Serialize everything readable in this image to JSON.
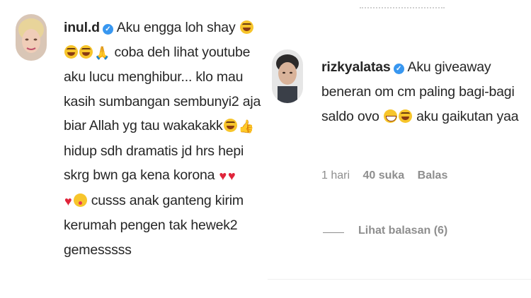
{
  "left_comment": {
    "username": "inul.d",
    "lines": [
      [
        "Aku engga loh shay"
      ],
      [
        "coba deh lihat youtube"
      ],
      [
        "aku lucu menghibur... klo mau"
      ],
      [
        "kasih sumbangan sembunyi2 aja"
      ],
      [
        "biar Allah yg tau wakakakk"
      ],
      [
        "hidup sdh dramatis jd hrs hepi"
      ],
      [
        "skrg bwn ga kena korona"
      ],
      [
        "cusss anak ganteng kirim"
      ],
      [
        "kerumah pengen tak hewek2"
      ],
      [
        "gemesssss"
      ]
    ],
    "icons": {
      "verified": "verified-badge-icon",
      "laugh": "rolling-laughing-emoji",
      "pray": "folded-hands-emoji",
      "thumb": "thumbs-up-emoji",
      "heart": "red-heart-emoji",
      "wink": "kissing-wink-emoji"
    }
  },
  "right_comment": {
    "username": "rizkyalatas",
    "lines": [
      "Aku giveaway",
      "beneran om cm paling bagi-bagi",
      "saldo ovo",
      "aku gaikutan yaa"
    ],
    "meta": {
      "time": "1 hari",
      "likes": "40 suka",
      "reply": "Balas"
    },
    "view_replies": "Lihat balasan (6)"
  },
  "colors": {
    "verified_blue": "#3897f0",
    "meta_gray": "#8e8e8e",
    "text": "#262626"
  }
}
